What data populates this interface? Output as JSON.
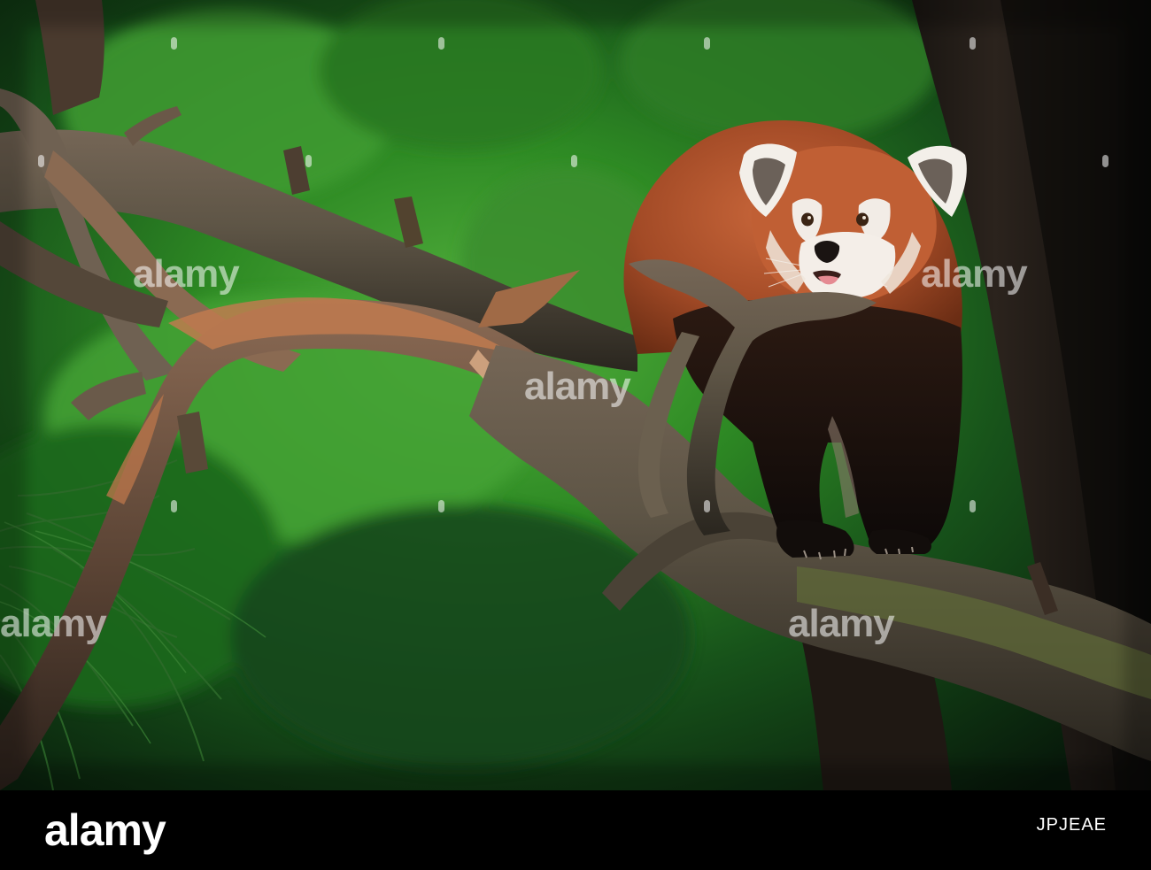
{
  "photo": {
    "subject": "red panda on a tree branch",
    "palette": {
      "background_green": "#2f7a24",
      "deep_green": "#0f2d0b",
      "dark_trunk": "#2a1a12",
      "fur_red": "#b6542c",
      "fur_dark": "#17120f",
      "face_white": "#f2ece6",
      "branch_brown": "#7c5a43",
      "moss_green": "#5c6b35"
    }
  },
  "watermark": {
    "text": "alamy",
    "dots": 12
  },
  "footer": {
    "brand": "alamy",
    "image_id": "JPJEAE"
  }
}
